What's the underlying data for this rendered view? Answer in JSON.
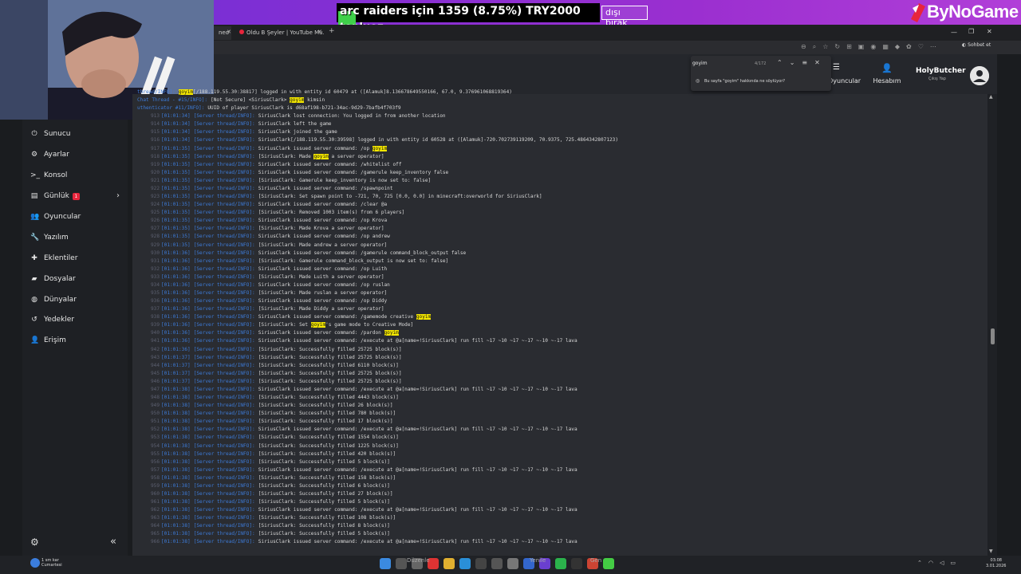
{
  "banner": {
    "donation_text": "arc raiders için 1359 (8.75%) TRY2000",
    "donation_user": "topluoz",
    "skip_label": "dışı bırak",
    "logo": "ByNoGame"
  },
  "browser": {
    "tabs": [
      "neo",
      "Oldu B Şeyler | YouTube Mu..."
    ],
    "new_tab": "+"
  },
  "find": {
    "query": "goyim",
    "count": "4/172",
    "hint": "Bu sayfa \"goyim\" hakkında ne söylüyor?"
  },
  "header": {
    "players_label": "Oyuncular",
    "account_label": "Hesabım",
    "user_name": "HolyButcher",
    "user_sub": "Çıkış Yap"
  },
  "sidebar": {
    "items": [
      {
        "label": "Sunucu",
        "icon": "power-icon"
      },
      {
        "label": "Ayarlar",
        "icon": "gear-icon"
      },
      {
        "label": "Konsol",
        "icon": "terminal-icon"
      },
      {
        "label": "Günlük",
        "icon": "document-icon",
        "badge": "1"
      },
      {
        "label": "Oyuncular",
        "icon": "users-icon"
      },
      {
        "label": "Yazılım",
        "icon": "wrench-icon"
      },
      {
        "label": "Eklentiler",
        "icon": "puzzle-icon"
      },
      {
        "label": "Dosyalar",
        "icon": "folder-icon"
      },
      {
        "label": "Dünyalar",
        "icon": "globe-icon"
      },
      {
        "label": "Yedekler",
        "icon": "history-icon"
      },
      {
        "label": "Erişim",
        "icon": "user-lock-icon"
      }
    ]
  },
  "console": {
    "lines": [
      {
        "n": "",
        "ts": "",
        "th": "thread/INFO]:",
        "pre": "",
        "hl": "goyim",
        "post": "[/188.119.55.30:38817] logged in with entity id 60479 at ([Alamuk]8.136678649550166, 67.0, 9.376961068819364)"
      },
      {
        "n": "",
        "ts": "",
        "th": "Chat Thread - #15/INFO]:",
        "pre": "[Not Secure] <SiriusClark> ",
        "hl": "goyim",
        "post": " kimsin"
      },
      {
        "n": "",
        "ts": "",
        "th": "uthenticator #11/INFO]:",
        "pre": "UUID of player SiriusClark is d68af198-b721-34ac-9d29-7bafb4f703f9",
        "hl": "",
        "post": ""
      },
      {
        "n": "913",
        "ts": "[01:01:34]",
        "th": "[Server thread/INFO]:",
        "pre": "SiriusClark lost connection: You logged in from another location",
        "hl": "",
        "post": ""
      },
      {
        "n": "914",
        "ts": "[01:01:34]",
        "th": "[Server thread/INFO]:",
        "pre": "SiriusClark left the game",
        "hl": "",
        "post": ""
      },
      {
        "n": "915",
        "ts": "[01:01:34]",
        "th": "[Server thread/INFO]:",
        "pre": "SiriusClark joined the game",
        "hl": "",
        "post": ""
      },
      {
        "n": "916",
        "ts": "[01:01:34]",
        "th": "[Server thread/INFO]:",
        "pre": "SiriusClark[/188.119.55.30:39598] logged in with entity id 60528 at ([Alamuk]-720.702739119209, 70.9375, 725.4864342807123)",
        "hl": "",
        "post": ""
      },
      {
        "n": "917",
        "ts": "[01:01:35]",
        "th": "[Server thread/INFO]:",
        "pre": "SiriusClark issued server command: /op ",
        "hl": "goyim",
        "post": ""
      },
      {
        "n": "918",
        "ts": "[01:01:35]",
        "th": "[Server thread/INFO]:",
        "pre": "[SiriusClark: Made ",
        "hl": "goyim",
        "post": " a server operator]"
      },
      {
        "n": "919",
        "ts": "[01:01:35]",
        "th": "[Server thread/INFO]:",
        "pre": "SiriusClark issued server command: /whitelist off",
        "hl": "",
        "post": ""
      },
      {
        "n": "920",
        "ts": "[01:01:35]",
        "th": "[Server thread/INFO]:",
        "pre": "SiriusClark issued server command: /gamerule keep_inventory false",
        "hl": "",
        "post": ""
      },
      {
        "n": "921",
        "ts": "[01:01:35]",
        "th": "[Server thread/INFO]:",
        "pre": "[SiriusClark: Gamerule keep_inventory is now set to: false]",
        "hl": "",
        "post": ""
      },
      {
        "n": "922",
        "ts": "[01:01:35]",
        "th": "[Server thread/INFO]:",
        "pre": "SiriusClark issued server command: /spawnpoint",
        "hl": "",
        "post": ""
      },
      {
        "n": "923",
        "ts": "[01:01:35]",
        "th": "[Server thread/INFO]:",
        "pre": "[SiriusClark: Set spawn point to -721, 70, 725 [0.0, 0.0] in minecraft:overworld for SiriusClark]",
        "hl": "",
        "post": ""
      },
      {
        "n": "924",
        "ts": "[01:01:35]",
        "th": "[Server thread/INFO]:",
        "pre": "SiriusClark issued server command: /clear @a",
        "hl": "",
        "post": ""
      },
      {
        "n": "925",
        "ts": "[01:01:35]",
        "th": "[Server thread/INFO]:",
        "pre": "[SiriusClark: Removed 1003 item(s) from 6 players]",
        "hl": "",
        "post": ""
      },
      {
        "n": "926",
        "ts": "[01:01:35]",
        "th": "[Server thread/INFO]:",
        "pre": "SiriusClark issued server command: /op Krova",
        "hl": "",
        "post": ""
      },
      {
        "n": "927",
        "ts": "[01:01:35]",
        "th": "[Server thread/INFO]:",
        "pre": "[SiriusClark: Made Krova a server operator]",
        "hl": "",
        "post": ""
      },
      {
        "n": "928",
        "ts": "[01:01:35]",
        "th": "[Server thread/INFO]:",
        "pre": "SiriusClark issued server command: /op andrew",
        "hl": "",
        "post": ""
      },
      {
        "n": "929",
        "ts": "[01:01:35]",
        "th": "[Server thread/INFO]:",
        "pre": "[SiriusClark: Made andrew a server operator]",
        "hl": "",
        "post": ""
      },
      {
        "n": "930",
        "ts": "[01:01:36]",
        "th": "[Server thread/INFO]:",
        "pre": "SiriusClark issued server command: /gamerule command_block_output false",
        "hl": "",
        "post": ""
      },
      {
        "n": "931",
        "ts": "[01:01:36]",
        "th": "[Server thread/INFO]:",
        "pre": "[SiriusClark: Gamerule command_block_output is now set to: false]",
        "hl": "",
        "post": ""
      },
      {
        "n": "932",
        "ts": "[01:01:36]",
        "th": "[Server thread/INFO]:",
        "pre": "SiriusClark issued server command: /op Luith",
        "hl": "",
        "post": ""
      },
      {
        "n": "933",
        "ts": "[01:01:36]",
        "th": "[Server thread/INFO]:",
        "pre": "[SiriusClark: Made Luith a server operator]",
        "hl": "",
        "post": ""
      },
      {
        "n": "934",
        "ts": "[01:01:36]",
        "th": "[Server thread/INFO]:",
        "pre": "SiriusClark issued server command: /op ruslan",
        "hl": "",
        "post": ""
      },
      {
        "n": "935",
        "ts": "[01:01:36]",
        "th": "[Server thread/INFO]:",
        "pre": "[SiriusClark: Made ruslan a server operator]",
        "hl": "",
        "post": ""
      },
      {
        "n": "936",
        "ts": "[01:01:36]",
        "th": "[Server thread/INFO]:",
        "pre": "SiriusClark issued server command: /op Diddy",
        "hl": "",
        "post": ""
      },
      {
        "n": "937",
        "ts": "[01:01:36]",
        "th": "[Server thread/INFO]:",
        "pre": "[SiriusClark: Made Diddy a server operator]",
        "hl": "",
        "post": ""
      },
      {
        "n": "938",
        "ts": "[01:01:36]",
        "th": "[Server thread/INFO]:",
        "pre": "SiriusClark issued server command: /gamemode creative ",
        "hl": "goyim",
        "post": ""
      },
      {
        "n": "939",
        "ts": "[01:01:36]",
        "th": "[Server thread/INFO]:",
        "pre": "[SiriusClark: Set ",
        "hl": "goyim",
        "post": "'s game mode to Creative Mode]"
      },
      {
        "n": "940",
        "ts": "[01:01:36]",
        "th": "[Server thread/INFO]:",
        "pre": "SiriusClark issued server command: /pardon ",
        "hl": "goyim",
        "post": ""
      },
      {
        "n": "941",
        "ts": "[01:01:36]",
        "th": "[Server thread/INFO]:",
        "pre": "SiriusClark issued server command: /execute at @a[name=!SiriusClark] run fill ~17 ~10 ~17 ~-17 ~-10 ~-17 lava",
        "hl": "",
        "post": ""
      },
      {
        "n": "942",
        "ts": "[01:01:36]",
        "th": "[Server thread/INFO]:",
        "pre": "[SiriusClark: Successfully filled 25725 block(s)]",
        "hl": "",
        "post": ""
      },
      {
        "n": "943",
        "ts": "[01:01:37]",
        "th": "[Server thread/INFO]:",
        "pre": "[SiriusClark: Successfully filled 25725 block(s)]",
        "hl": "",
        "post": ""
      },
      {
        "n": "944",
        "ts": "[01:01:37]",
        "th": "[Server thread/INFO]:",
        "pre": "[SiriusClark: Successfully filled 6110 block(s)]",
        "hl": "",
        "post": ""
      },
      {
        "n": "945",
        "ts": "[01:01:37]",
        "th": "[Server thread/INFO]:",
        "pre": "[SiriusClark: Successfully filled 25725 block(s)]",
        "hl": "",
        "post": ""
      },
      {
        "n": "946",
        "ts": "[01:01:37]",
        "th": "[Server thread/INFO]:",
        "pre": "[SiriusClark: Successfully filled 25725 block(s)]",
        "hl": "",
        "post": ""
      },
      {
        "n": "947",
        "ts": "[01:01:38]",
        "th": "[Server thread/INFO]:",
        "pre": "SiriusClark issued server command: /execute at @a[name=!SiriusClark] run fill ~17 ~10 ~17 ~-17 ~-10 ~-17 lava",
        "hl": "",
        "post": ""
      },
      {
        "n": "948",
        "ts": "[01:01:38]",
        "th": "[Server thread/INFO]:",
        "pre": "[SiriusClark: Successfully filled 4443 block(s)]",
        "hl": "",
        "post": ""
      },
      {
        "n": "949",
        "ts": "[01:01:38]",
        "th": "[Server thread/INFO]:",
        "pre": "[SiriusClark: Successfully filled 26 block(s)]",
        "hl": "",
        "post": ""
      },
      {
        "n": "950",
        "ts": "[01:01:38]",
        "th": "[Server thread/INFO]:",
        "pre": "[SiriusClark: Successfully filled 780 block(s)]",
        "hl": "",
        "post": ""
      },
      {
        "n": "951",
        "ts": "[01:01:38]",
        "th": "[Server thread/INFO]:",
        "pre": "[SiriusClark: Successfully filled 17 block(s)]",
        "hl": "",
        "post": ""
      },
      {
        "n": "952",
        "ts": "[01:01:38]",
        "th": "[Server thread/INFO]:",
        "pre": "SiriusClark issued server command: /execute at @a[name=!SiriusClark] run fill ~17 ~10 ~17 ~-17 ~-10 ~-17 lava",
        "hl": "",
        "post": ""
      },
      {
        "n": "953",
        "ts": "[01:01:38]",
        "th": "[Server thread/INFO]:",
        "pre": "[SiriusClark: Successfully filled 1554 block(s)]",
        "hl": "",
        "post": ""
      },
      {
        "n": "954",
        "ts": "[01:01:38]",
        "th": "[Server thread/INFO]:",
        "pre": "[SiriusClark: Successfully filled 1225 block(s)]",
        "hl": "",
        "post": ""
      },
      {
        "n": "955",
        "ts": "[01:01:38]",
        "th": "[Server thread/INFO]:",
        "pre": "[SiriusClark: Successfully filled 420 block(s)]",
        "hl": "",
        "post": ""
      },
      {
        "n": "956",
        "ts": "[01:01:38]",
        "th": "[Server thread/INFO]:",
        "pre": "[SiriusClark: Successfully filled 5 block(s)]",
        "hl": "",
        "post": ""
      },
      {
        "n": "957",
        "ts": "[01:01:38]",
        "th": "[Server thread/INFO]:",
        "pre": "SiriusClark issued server command: /execute at @a[name=!SiriusClark] run fill ~17 ~10 ~17 ~-17 ~-10 ~-17 lava",
        "hl": "",
        "post": ""
      },
      {
        "n": "958",
        "ts": "[01:01:38]",
        "th": "[Server thread/INFO]:",
        "pre": "[SiriusClark: Successfully filled 158 block(s)]",
        "hl": "",
        "post": ""
      },
      {
        "n": "959",
        "ts": "[01:01:38]",
        "th": "[Server thread/INFO]:",
        "pre": "[SiriusClark: Successfully filled 6 block(s)]",
        "hl": "",
        "post": ""
      },
      {
        "n": "960",
        "ts": "[01:01:38]",
        "th": "[Server thread/INFO]:",
        "pre": "[SiriusClark: Successfully filled 27 block(s)]",
        "hl": "",
        "post": ""
      },
      {
        "n": "961",
        "ts": "[01:01:38]",
        "th": "[Server thread/INFO]:",
        "pre": "[SiriusClark: Successfully filled 5 block(s)]",
        "hl": "",
        "post": ""
      },
      {
        "n": "962",
        "ts": "[01:01:38]",
        "th": "[Server thread/INFO]:",
        "pre": "SiriusClark issued server command: /execute at @a[name=!SiriusClark] run fill ~17 ~10 ~17 ~-17 ~-10 ~-17 lava",
        "hl": "",
        "post": ""
      },
      {
        "n": "963",
        "ts": "[01:01:38]",
        "th": "[Server thread/INFO]:",
        "pre": "[SiriusClark: Successfully filled 108 block(s)]",
        "hl": "",
        "post": ""
      },
      {
        "n": "964",
        "ts": "[01:01:38]",
        "th": "[Server thread/INFO]:",
        "pre": "[SiriusClark: Successfully filled 8 block(s)]",
        "hl": "",
        "post": ""
      },
      {
        "n": "965",
        "ts": "[01:01:38]",
        "th": "[Server thread/INFO]:",
        "pre": "[SiriusClark: Successfully filled 5 block(s)]",
        "hl": "",
        "post": ""
      },
      {
        "n": "966",
        "ts": "[01:01:38]",
        "th": "[Server thread/INFO]:",
        "pre": "SiriusClark issued server command: /execute at @a[name=!SiriusClark] run fill ~17 ~10 ~17 ~-17 ~-10 ~-17 lava",
        "hl": "",
        "post": ""
      }
    ]
  },
  "taskbar": {
    "weather": "1 sm kar",
    "weather_sub": "Cumartesi",
    "items": [
      "Düzenle",
      "Yenile",
      "Gen"
    ],
    "time": "03:08",
    "date": "3.01.2026"
  },
  "colors": {
    "banner": "#8a2ec7",
    "highlight": "#f5e800",
    "badge": "#e8253c",
    "thread": "#3d7bd8"
  }
}
